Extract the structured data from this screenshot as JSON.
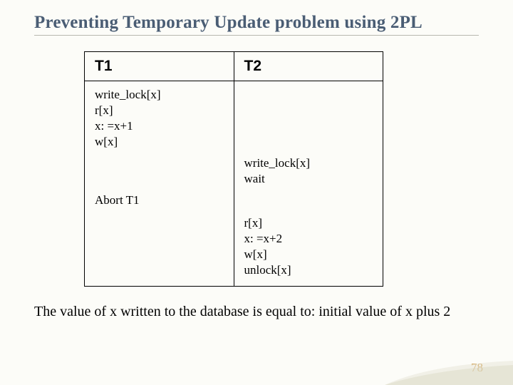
{
  "title": "Preventing Temporary Update problem using 2PL",
  "columns": {
    "t1": "T1",
    "t2": "T2"
  },
  "t1_block1": "write_lock[x]\nr[x]\nx: =x+1\nw[x]",
  "t1_block2": "Abort T1",
  "t2_block1": "write_lock[x]\nwait",
  "t2_block2": "r[x]\nx: =x+2\nw[x]\nunlock[x]",
  "conclusion": "The value of x written to the database is equal to: initial value of x plus 2",
  "pagenum": "78"
}
